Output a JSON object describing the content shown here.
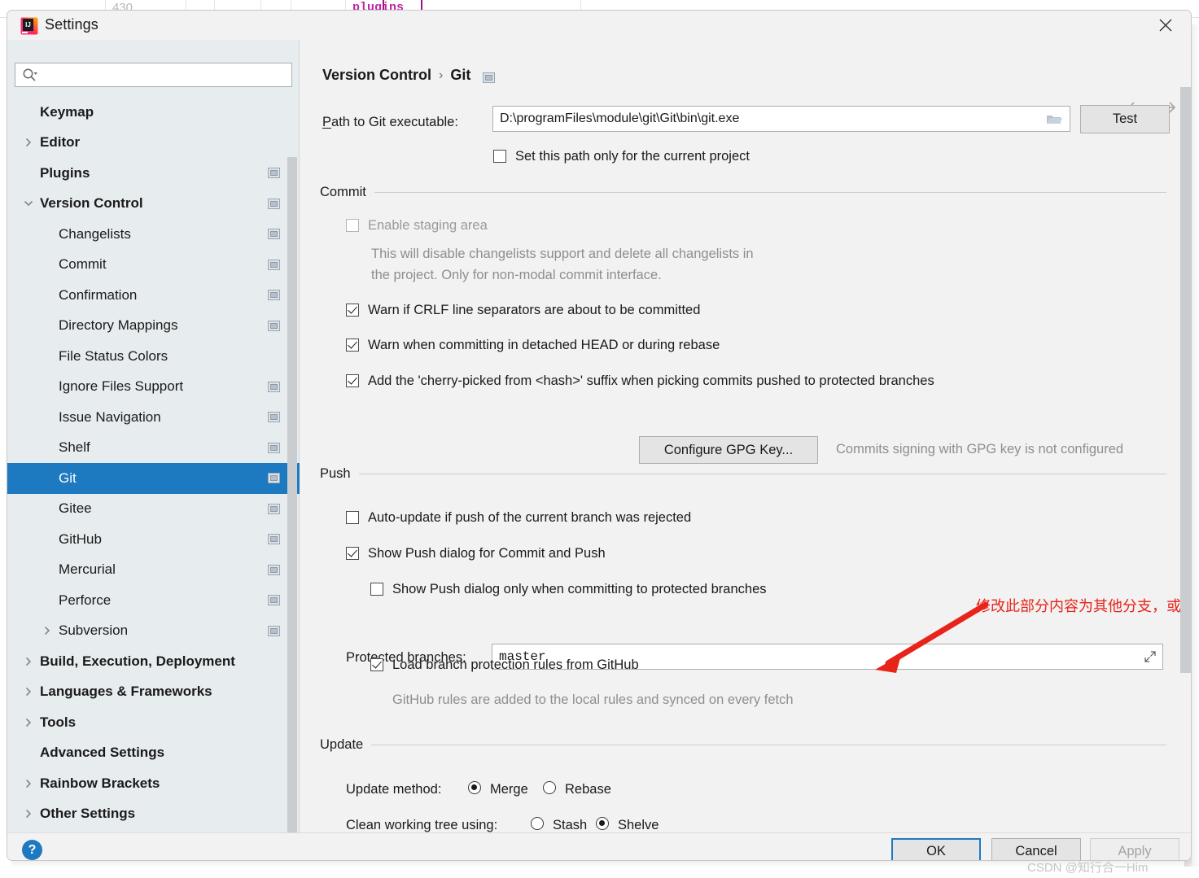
{
  "window": {
    "title": "Settings",
    "app_icon": "intellij-idea-icon",
    "close_icon": "close-icon"
  },
  "search": {
    "placeholder": "",
    "value": "",
    "icon": "search-icon"
  },
  "sidebar": {
    "items": [
      {
        "label": "Keymap",
        "indent": 40,
        "bold": true,
        "arrow": "none",
        "proj": false,
        "selected": false
      },
      {
        "label": "Editor",
        "indent": 40,
        "bold": true,
        "arrow": "right",
        "proj": false,
        "selected": false
      },
      {
        "label": "Plugins",
        "indent": 40,
        "bold": true,
        "arrow": "none",
        "proj": true,
        "selected": false
      },
      {
        "label": "Version Control",
        "indent": 40,
        "bold": true,
        "arrow": "down",
        "proj": true,
        "selected": false
      },
      {
        "label": "Changelists",
        "indent": 63,
        "bold": false,
        "arrow": "none",
        "proj": true,
        "selected": false
      },
      {
        "label": "Commit",
        "indent": 63,
        "bold": false,
        "arrow": "none",
        "proj": true,
        "selected": false
      },
      {
        "label": "Confirmation",
        "indent": 63,
        "bold": false,
        "arrow": "none",
        "proj": true,
        "selected": false
      },
      {
        "label": "Directory Mappings",
        "indent": 63,
        "bold": false,
        "arrow": "none",
        "proj": true,
        "selected": false
      },
      {
        "label": "File Status Colors",
        "indent": 63,
        "bold": false,
        "arrow": "none",
        "proj": false,
        "selected": false
      },
      {
        "label": "Ignore Files Support",
        "indent": 63,
        "bold": false,
        "arrow": "none",
        "proj": true,
        "selected": false
      },
      {
        "label": "Issue Navigation",
        "indent": 63,
        "bold": false,
        "arrow": "none",
        "proj": true,
        "selected": false
      },
      {
        "label": "Shelf",
        "indent": 63,
        "bold": false,
        "arrow": "none",
        "proj": true,
        "selected": false
      },
      {
        "label": "Git",
        "indent": 63,
        "bold": false,
        "arrow": "none",
        "proj": true,
        "selected": true
      },
      {
        "label": "Gitee",
        "indent": 63,
        "bold": false,
        "arrow": "none",
        "proj": true,
        "selected": false
      },
      {
        "label": "GitHub",
        "indent": 63,
        "bold": false,
        "arrow": "none",
        "proj": true,
        "selected": false
      },
      {
        "label": "Mercurial",
        "indent": 63,
        "bold": false,
        "arrow": "none",
        "proj": true,
        "selected": false
      },
      {
        "label": "Perforce",
        "indent": 63,
        "bold": false,
        "arrow": "none",
        "proj": true,
        "selected": false
      },
      {
        "label": "Subversion",
        "indent": 63,
        "bold": false,
        "arrow": "right",
        "proj": true,
        "selected": false
      },
      {
        "label": "Build, Execution, Deployment",
        "indent": 40,
        "bold": true,
        "arrow": "right",
        "proj": false,
        "selected": false
      },
      {
        "label": "Languages & Frameworks",
        "indent": 40,
        "bold": true,
        "arrow": "right",
        "proj": false,
        "selected": false
      },
      {
        "label": "Tools",
        "indent": 40,
        "bold": true,
        "arrow": "right",
        "proj": false,
        "selected": false
      },
      {
        "label": "Advanced Settings",
        "indent": 40,
        "bold": true,
        "arrow": "none",
        "proj": false,
        "selected": false
      },
      {
        "label": "Rainbow Brackets",
        "indent": 40,
        "bold": true,
        "arrow": "right",
        "proj": false,
        "selected": false
      },
      {
        "label": "Other Settings",
        "indent": 40,
        "bold": true,
        "arrow": "right",
        "proj": false,
        "selected": false
      }
    ]
  },
  "breadcrumb": {
    "root": "Version Control",
    "separator": "›",
    "current": "Git",
    "proj_icon": "project-level-setting-icon"
  },
  "nav": {
    "back_icon": "arrow-left-icon",
    "forward_icon": "arrow-right-icon"
  },
  "git_path": {
    "label": "Path to Git executable:",
    "label_mnemonic": "P",
    "label_rest": "ath to Git executable:",
    "value": "D:\\programFiles\\module\\git\\Git\\bin\\git.exe",
    "browse_icon": "folder-icon",
    "test_label": "Test",
    "only_current_project": {
      "label": "Set this path only for the current project",
      "checked": false
    }
  },
  "commit": {
    "section_title": "Commit",
    "enable_staging": {
      "label": "Enable staging area",
      "checked": false,
      "disabled": true
    },
    "staging_help_line1": "This will disable changelists support and delete all changelists in",
    "staging_help_line2": "the project. Only for non-modal commit interface.",
    "warn_crlf": {
      "label": "Warn if CRLF line separators are about to be committed",
      "checked": true
    },
    "warn_detached": {
      "label": "Warn when committing in detached HEAD or during rebase",
      "checked": true
    },
    "cherry_pick": {
      "label": "Add the 'cherry-picked from <hash>' suffix when picking commits pushed to protected branches",
      "checked": true
    },
    "gpg_button": "Configure GPG Key...",
    "gpg_note": "Commits signing with GPG key is not configured"
  },
  "push": {
    "section_title": "Push",
    "auto_update": {
      "label": "Auto-update if push of the current branch was rejected",
      "checked": false
    },
    "show_push_dialog": {
      "label": "Show Push dialog for Commit and Push",
      "checked": true
    },
    "show_push_protected": {
      "label": "Show Push dialog only when committing to protected branches",
      "checked": false
    },
    "protected_branches": {
      "label": "Protected branches:",
      "value": "master",
      "expand_icon": "expand-icon"
    },
    "load_github_rules": {
      "label": "Load branch protection rules from GitHub",
      "checked": true
    },
    "github_note": "GitHub rules are added to the local rules and synced on every fetch"
  },
  "update": {
    "section_title": "Update",
    "method_label": "Update method:",
    "method_options": [
      {
        "label": "Merge",
        "selected": true
      },
      {
        "label": "Rebase",
        "selected": false
      }
    ],
    "clean_label": "Clean working tree using:",
    "clean_options": [
      {
        "label": "Stash",
        "selected": false
      },
      {
        "label": "Shelve",
        "selected": true
      }
    ]
  },
  "annotation": {
    "text": "修改此部分内容为其他分支，或者直接删除",
    "color": "#e8231a",
    "arrow_icon": "annotation-arrow-icon"
  },
  "footer": {
    "help_label": "?",
    "ok_label": "OK",
    "cancel_label": "Cancel",
    "apply_label": "Apply",
    "apply_disabled": true
  },
  "watermark": "CSDN @知行合一Him",
  "backdrop": {
    "line_number": "430",
    "tag_text": "plugins"
  },
  "colors": {
    "accent": "#1e7ac0",
    "selection": "#1e7ac0",
    "dialog_bg": "#f2f2f2",
    "sidebar_bg": "#e7ecef",
    "annotation_red": "#e8231a"
  }
}
